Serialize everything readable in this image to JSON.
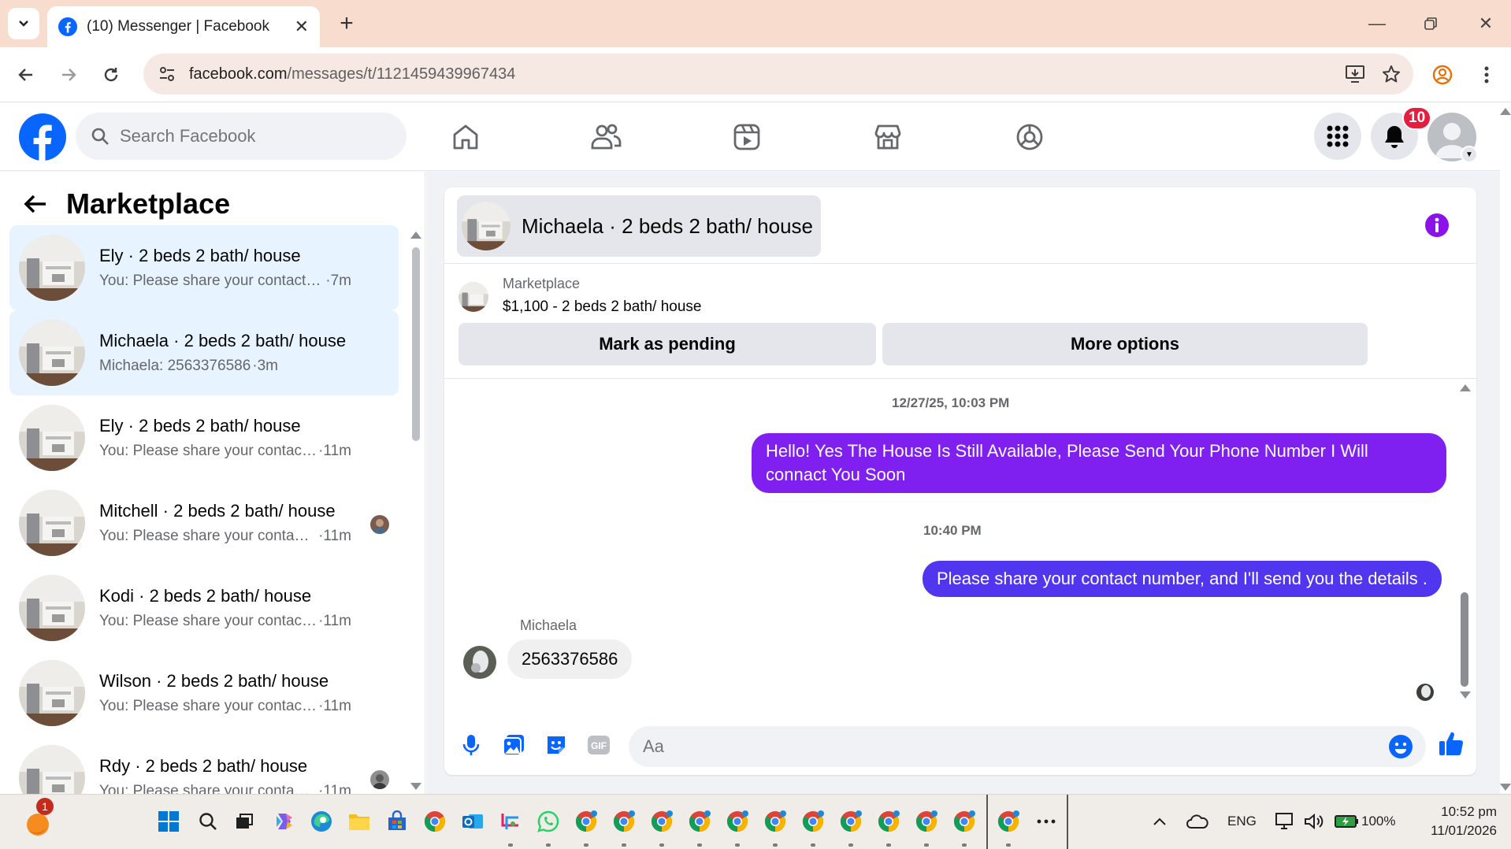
{
  "browser": {
    "tab_title": "(10) Messenger | Facebook",
    "url_host": "facebook.com",
    "url_path": "/messages/t/1121459439967434"
  },
  "fb_header": {
    "search_placeholder": "Search Facebook",
    "notification_count": "10",
    "brand_color": "#0866ff"
  },
  "left_panel": {
    "title": "Marketplace",
    "conversations": [
      {
        "name": "Ely · 2 beds 2 bath/ house",
        "preview": "You: Please share your contact nu...",
        "time": "·7m"
      },
      {
        "name": "Michaela · 2 beds 2 bath/ house",
        "preview": "Michaela: 2563376586",
        "time": "·3m"
      },
      {
        "name": "Ely · 2 beds 2 bath/ house",
        "preview": "You: Please share your contact nu...",
        "time": "·11m"
      },
      {
        "name": "Mitchell · 2 beds 2 bath/ house",
        "preview": "You: Please share your contact...",
        "time": "·11m"
      },
      {
        "name": "Kodi · 2 beds 2 bath/ house",
        "preview": "You: Please share your contact nu...",
        "time": "·11m"
      },
      {
        "name": "Wilson · 2 beds 2 bath/ house",
        "preview": "You: Please share your contact nu...",
        "time": "·11m"
      },
      {
        "name": "Rdy · 2 beds 2 bath/ house",
        "preview": "You: Please share your contact...",
        "time": "·11m"
      }
    ]
  },
  "chat": {
    "title": "Michaela · 2 beds 2 bath/ house",
    "listing_label": "Marketplace",
    "listing_price": "$1,100 - 2 beds 2 bath/ house",
    "btn_pending": "Mark as pending",
    "btn_more": "More options",
    "timestamp1": "12/27/25, 10:03 PM",
    "msg1": "Hello! Yes The House  Is Still Available, Please Send Your Phone Number I Will connact You Soon",
    "timestamp2": "10:40 PM",
    "msg2": "Please share your contact number, and I'll send you the details .",
    "sender": "Michaela",
    "msg3": "2563376586",
    "composer_placeholder": "Aa",
    "accent_purple": "#7f1ff0",
    "accent_blue": "#5136f0"
  },
  "taskbar": {
    "weather_badge": "1",
    "language": "ENG",
    "battery": "100%",
    "time": "10:52 pm",
    "date": "11/01/2026"
  }
}
